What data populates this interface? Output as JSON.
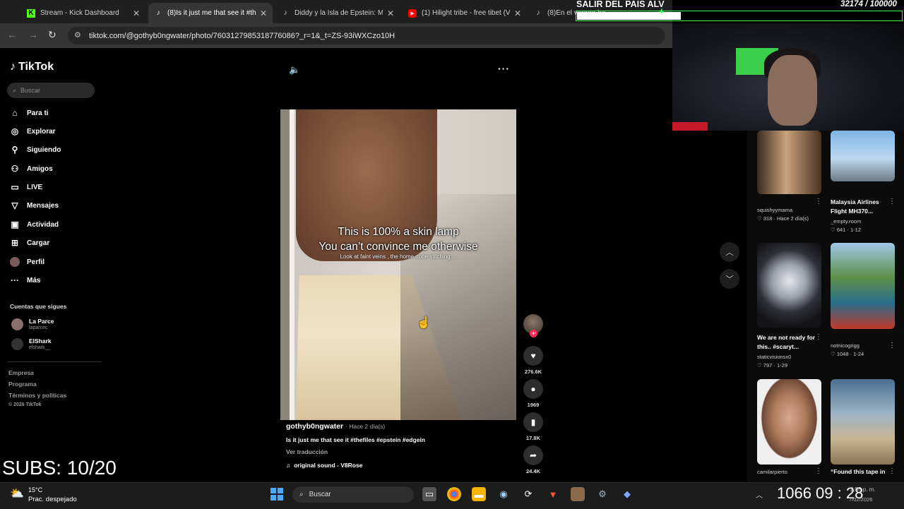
{
  "browser": {
    "tabs": [
      {
        "title": "Stream - Kick Dashboard",
        "active": false,
        "favicon": "kick-icon"
      },
      {
        "title": "(8)Is it just me that see it #th",
        "active": true,
        "favicon": "tiktok-icon"
      },
      {
        "title": "Diddy y la Isla de Epstein: M",
        "active": false,
        "favicon": "tiktok-icon"
      },
      {
        "title": "(1) Hilight tribe - free tibet (V",
        "active": false,
        "favicon": "youtube-icon"
      },
      {
        "title": "(8)En el verano ha de esta",
        "active": false,
        "favicon": "tiktok-icon"
      }
    ],
    "url": "tiktok.com/@gothyb0ngwater/photo/7603127985318776086?_r=1&_t=ZS-93iWXCzo10H"
  },
  "tiktok": {
    "logo": "TikTok",
    "search_placeholder": "Buscar",
    "nav": [
      {
        "label": "Para ti",
        "icon": "home-icon"
      },
      {
        "label": "Explorar",
        "icon": "compass-icon"
      },
      {
        "label": "Siguiendo",
        "icon": "following-icon"
      },
      {
        "label": "Amigos",
        "icon": "friends-icon"
      },
      {
        "label": "LIVE",
        "icon": "live-icon"
      },
      {
        "label": "Mensajes",
        "icon": "messages-icon"
      },
      {
        "label": "Actividad",
        "icon": "activity-icon"
      },
      {
        "label": "Cargar",
        "icon": "upload-icon"
      },
      {
        "label": "Perfil",
        "icon": "profile-icon"
      },
      {
        "label": "Más",
        "icon": "more-icon"
      }
    ],
    "following_title": "Cuentas que sigues",
    "following": [
      {
        "name": "La Parce",
        "handle": "laparcec"
      },
      {
        "name": "ElShark",
        "handle": "elshark__"
      }
    ],
    "footer": [
      "Empresa",
      "Programa",
      "Términos y políticas",
      "© 2026 TikTok"
    ]
  },
  "post": {
    "caption_line1": "This is 100% a skin lamp",
    "caption_line2": "You can’t convince me otherwise",
    "caption_small": "Look at faint veins , the home done stitching....",
    "author": "gothyb0ngwater",
    "posted": "· Hace 2 día(s)",
    "description": "Is it just me that see it #thefiles #epstein #edgein",
    "translate": "Ver traducción",
    "sound": "original sound - V8Rose",
    "likes": "276.6K",
    "comments": "1969",
    "saves": "17.8K",
    "shares": "24.4K"
  },
  "related": [
    {
      "title": "",
      "author": "squishyymama",
      "likes": "318",
      "age": "Hace 2 día(s)"
    },
    {
      "title": "Malaysia Airlines Flight MH370...",
      "author": "_empty.room",
      "likes": "641",
      "age": "1-12"
    },
    {
      "title": "We are not ready for this.. #scaryt...",
      "author": "staticvisionsx0",
      "likes": "797",
      "age": "1-29"
    },
    {
      "title": "",
      "author": "notnicogrigg",
      "likes": "1048",
      "age": "1-24"
    },
    {
      "title": "",
      "author": "camilarpierto",
      "likes": "",
      "age": ""
    },
    {
      "title": "“Found this tape in",
      "author": "",
      "likes": "",
      "age": ""
    }
  ],
  "stream_overlay": {
    "goal_title": "SALIR DEL PAIS ALV",
    "goal_count": "32174 / 100000",
    "goal_progress": 0.32,
    "subs": "SUBS: 10/20"
  },
  "taskbar": {
    "weather_temp": "15°C",
    "weather_desc": "Prac. despejado",
    "search_placeholder": "Buscar",
    "overlay_clock": "1066  09 : 28",
    "time": "2:55 p. m.",
    "date": "7/02/2026"
  },
  "colors": {
    "tiktok_red": "#fe2c55",
    "goal_green": "#3cff5a",
    "windows_blue": "#4aa8ff"
  }
}
